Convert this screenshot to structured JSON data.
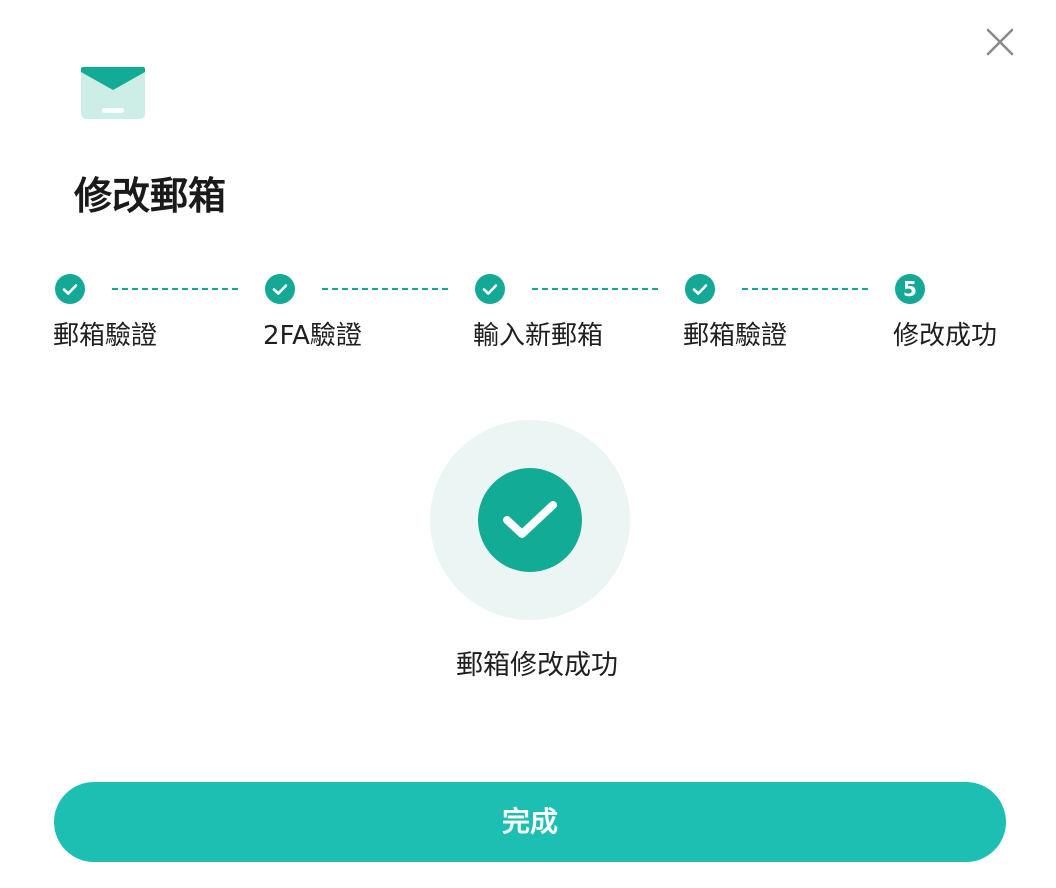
{
  "dialog": {
    "title": "修改郵箱",
    "close_icon": "close-icon",
    "header_icon": "mail-icon"
  },
  "stepper": {
    "steps": [
      {
        "label": "郵箱驗證",
        "status": "done",
        "icon": "check-icon"
      },
      {
        "label": "2FA驗證",
        "status": "done",
        "icon": "check-icon"
      },
      {
        "label": "輸入新郵箱",
        "status": "done",
        "icon": "check-icon"
      },
      {
        "label": "郵箱驗證",
        "status": "done",
        "icon": "check-icon"
      },
      {
        "label": "修改成功",
        "status": "current",
        "number": "5"
      }
    ]
  },
  "result": {
    "icon": "success-check-icon",
    "message": "郵箱修改成功"
  },
  "actions": {
    "done_label": "完成"
  },
  "colors": {
    "accent": "#14a896",
    "button": "#1cbfb2",
    "success_bg": "#ebf5f3",
    "mail_icon_body": "#cdeee7",
    "mail_icon_flap": "#12ab96"
  }
}
